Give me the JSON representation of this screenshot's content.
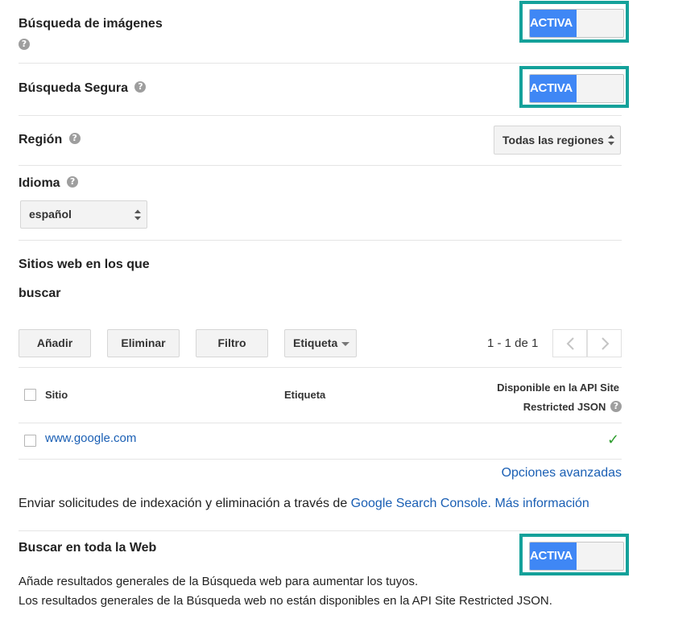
{
  "image_search": {
    "label": "Búsqueda de imágenes",
    "toggle_label": "ACTIVA"
  },
  "safe_search": {
    "label": "Búsqueda Segura",
    "toggle_label": "ACTIVA"
  },
  "region": {
    "label": "Región",
    "selected": "Todas las regiones"
  },
  "language": {
    "label": "Idioma",
    "selected": "español"
  },
  "sites": {
    "heading_line1": "Sitios web en los que",
    "heading_line2": "buscar",
    "add_label": "Añadir",
    "delete_label": "Eliminar",
    "filter_label": "Filtro",
    "tag_label": "Etiqueta",
    "pagination": "1 - 1 de 1",
    "columns": {
      "site": "Sitio",
      "tag": "Etiqueta",
      "available_line1": "Disponible en la API Site",
      "available_line2": "Restricted JSON"
    },
    "rows": [
      {
        "site": "www.google.com",
        "tag": "",
        "available": "✓"
      }
    ],
    "advanced_options": "Opciones avanzadas"
  },
  "indexing": {
    "text": "Enviar solicitudes de indexación y eliminación a través de",
    "console_link": "Google Search Console.",
    "more_info_link": "Más información"
  },
  "web_search": {
    "label": "Buscar en toda la Web",
    "toggle_label": "ACTIVA",
    "desc_line1": "Añade resultados generales de la Búsqueda web para aumentar los tuyos.",
    "desc_line2": "Los resultados generales de la Búsqueda web no están disponibles en la API Site Restricted JSON."
  },
  "colors": {
    "accent_toggle": "#3f87f5",
    "highlight_frame": "#14a19a",
    "link": "#1a5fb4",
    "check": "#2e9d2e"
  }
}
